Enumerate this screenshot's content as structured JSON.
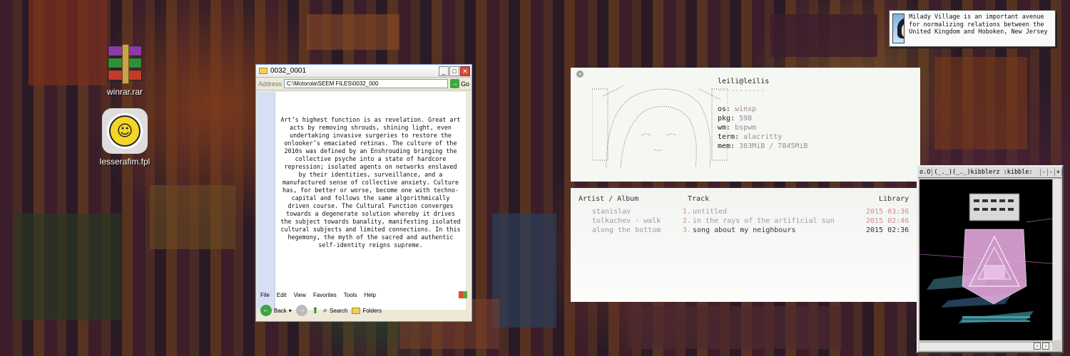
{
  "desktop": {
    "icons": [
      {
        "label": "winrar.rar",
        "icon": "winrar-archive-icon"
      },
      {
        "label": "lesserafim.fpl",
        "icon": "smiley-flower-playlist-icon"
      }
    ]
  },
  "explorer": {
    "title": "0032_0001",
    "address_label": "Address",
    "address_value": "C:\\Motorola\\SEEM FILES\\0032_000",
    "go_label": "Go",
    "document_text": "Art’s highest function is as revelation. Great art acts by removing shrouds, shining light, even undertaking invasive surgeries to restore the onlooker’s emaciated retinas. The culture of the 2010s was defined by an Enshrouding bringing the collective psyche into a state of hardcore repression; isolated agents on networks enslaved by their identities, surveillance, and a manufactured sense of collective anxiety. Culture has, for better or worse, become one with techno-capital and follows the same algorithmically driven course.  The Cultural Function converges towards a degenerate solution whereby it drives the subject towards banality, manifesting isolated cultural subjects and limited connections. In this hegemony, the myth of the sacred and authentic self-identity reigns supreme.",
    "menu": [
      "File",
      "Edit",
      "View",
      "Favorites",
      "Tools",
      "Help"
    ],
    "toolbar": {
      "back": "Back",
      "search": "Search",
      "folders": "Folders"
    }
  },
  "neofetch": {
    "userhost": "leili@leilis",
    "separator": "-----------",
    "fields": [
      {
        "key": "os:",
        "value": "winxp"
      },
      {
        "key": "pkg:",
        "value": "598"
      },
      {
        "key": "wm:",
        "value": "bspwm"
      },
      {
        "key": "term:",
        "value": "alacritty"
      },
      {
        "key": "mem:",
        "value": "383MiB / 7845MiB"
      }
    ]
  },
  "player": {
    "headers": {
      "artist_album": "Artist / Album",
      "track": "Track",
      "library": "Library"
    },
    "rows": [
      {
        "artist": "stanislav",
        "num": "1.",
        "title": "untitled",
        "year_time": "2015 03:36"
      },
      {
        "artist": "tolkachev - walk",
        "num": "2.",
        "title": "in the rays of the artificial sun",
        "year_time": "2015 02:46"
      },
      {
        "artist": "along the bottom",
        "num": "3.",
        "title": "song about my neighbours",
        "year_time": "2015 02:36"
      }
    ]
  },
  "notification": {
    "message": "Milady Village is an important avenue for normalizing relations between the United Kingdom and Hoboken, New Jersey"
  },
  "kibblerz": {
    "tabs": [
      "o.O",
      "(_._)(_._)kibblerz :kibble:",
      "-",
      "-",
      "+"
    ]
  },
  "colors": {
    "accent_pink": "#d08c98",
    "muted_mauve": "#a595a4",
    "xp_green": "#3caa3c"
  }
}
